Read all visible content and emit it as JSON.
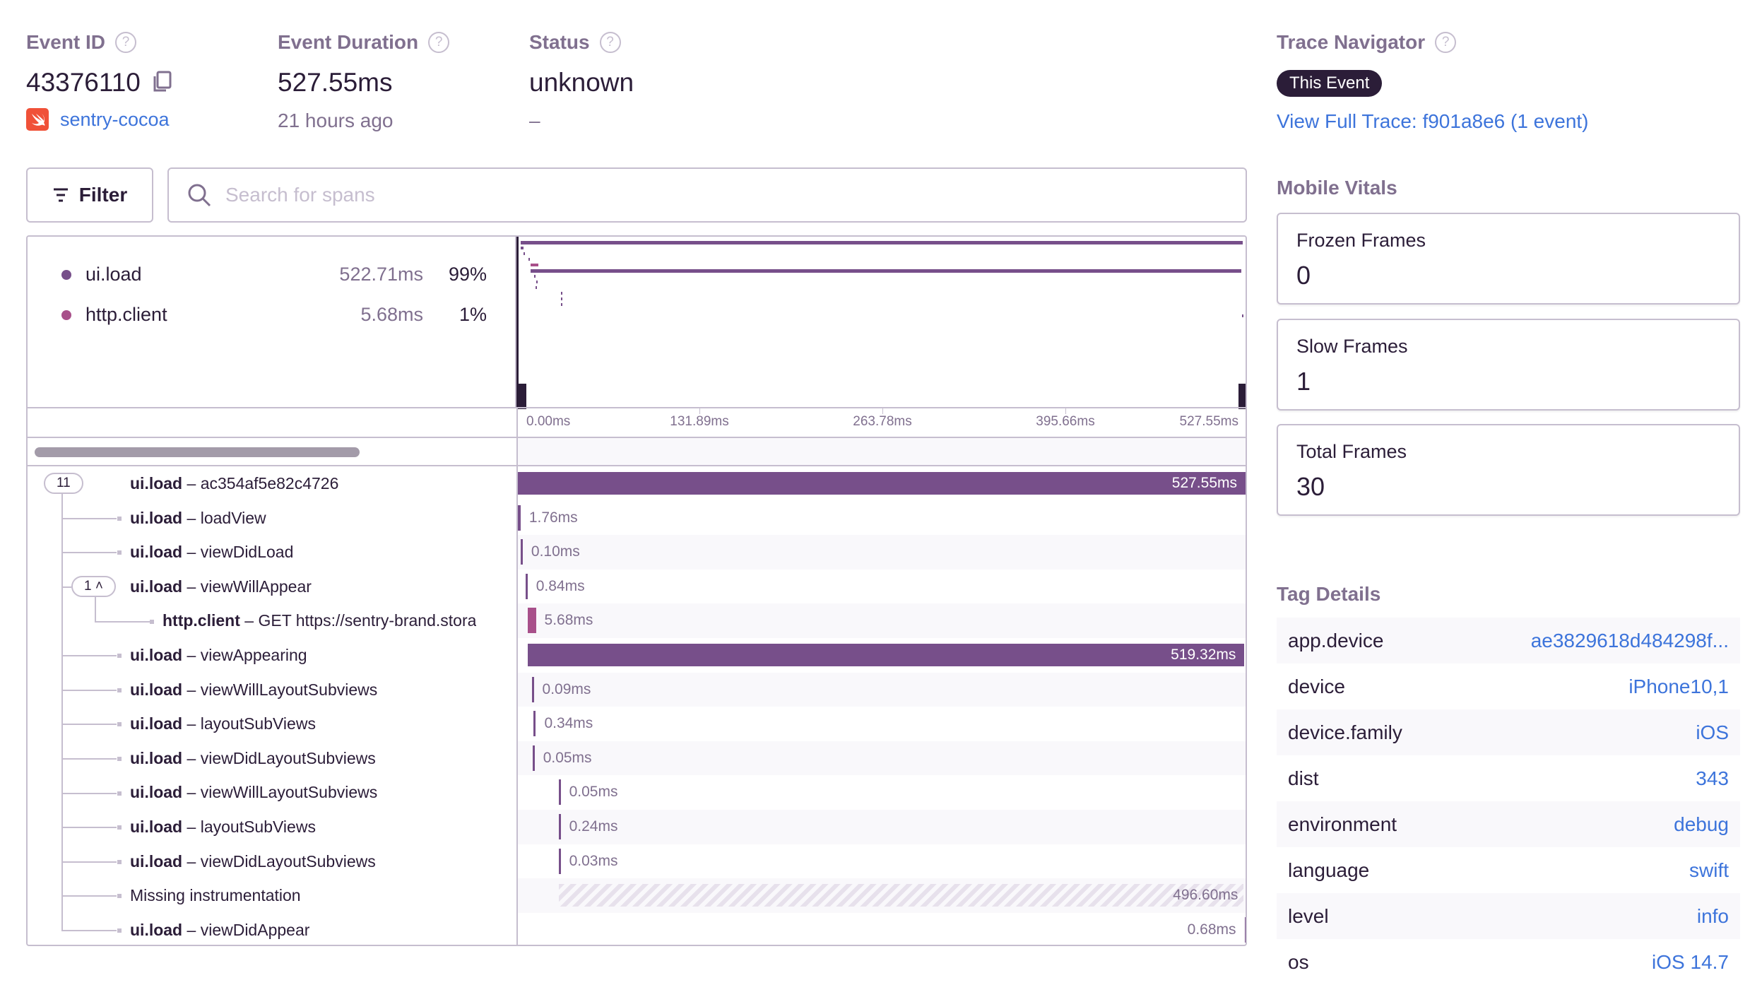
{
  "header": {
    "event_id": {
      "label": "Event ID",
      "value": "43376110",
      "project": "sentry-cocoa"
    },
    "duration": {
      "label": "Event Duration",
      "value": "527.55ms",
      "time_ago": "21 hours ago"
    },
    "status": {
      "label": "Status",
      "value": "unknown",
      "sub": "–"
    }
  },
  "toolbar": {
    "filter_label": "Filter",
    "search_placeholder": "Search for spans"
  },
  "ops_breakdown": [
    {
      "op": "ui.load",
      "duration": "522.71ms",
      "percent": "99%",
      "color": "#774f8a"
    },
    {
      "op": "http.client",
      "duration": "5.68ms",
      "percent": "1%",
      "color": "#a8508a"
    }
  ],
  "timeline": {
    "total_ms": 527.55,
    "ticks": [
      "0.00ms",
      "131.89ms",
      "263.78ms",
      "395.66ms",
      "527.55ms"
    ],
    "tick_values": [
      0,
      131.89,
      263.78,
      395.66,
      527.55
    ]
  },
  "spans": [
    {
      "op": "ui.load",
      "desc": "ac354af5e82c4726",
      "badge": "11",
      "depth": 0,
      "start": 0,
      "dur": 527.55,
      "label": "527.55ms"
    },
    {
      "op": "ui.load",
      "desc": "loadView",
      "depth": 1,
      "start": 0.2,
      "dur": 1.76,
      "label": "1.76ms"
    },
    {
      "op": "ui.load",
      "desc": "viewDidLoad",
      "depth": 1,
      "start": 2.0,
      "dur": 0.1,
      "label": "0.10ms"
    },
    {
      "op": "ui.load",
      "desc": "viewWillAppear",
      "badge": "1 ^",
      "depth": 1,
      "start": 5.5,
      "dur": 0.84,
      "label": "0.84ms"
    },
    {
      "op": "http.client",
      "desc": "GET https://sentry-brand.stora",
      "depth": 2,
      "start": 7.4,
      "dur": 5.68,
      "label": "5.68ms",
      "color": "#a8508a"
    },
    {
      "op": "ui.load",
      "desc": "viewAppearing",
      "depth": 1,
      "start": 7.4,
      "dur": 519.32,
      "label": "519.32ms"
    },
    {
      "op": "ui.load",
      "desc": "viewWillLayoutSubviews",
      "depth": 1,
      "start": 10.0,
      "dur": 0.09,
      "label": "0.09ms"
    },
    {
      "op": "ui.load",
      "desc": "layoutSubViews",
      "depth": 1,
      "start": 11.5,
      "dur": 0.34,
      "label": "0.34ms"
    },
    {
      "op": "ui.load",
      "desc": "viewDidLayoutSubviews",
      "depth": 1,
      "start": 10.6,
      "dur": 0.05,
      "label": "0.05ms"
    },
    {
      "op": "ui.load",
      "desc": "viewWillLayoutSubviews",
      "depth": 1,
      "start": 29.5,
      "dur": 0.05,
      "label": "0.05ms"
    },
    {
      "op": "ui.load",
      "desc": "layoutSubViews",
      "depth": 1,
      "start": 29.5,
      "dur": 0.24,
      "label": "0.24ms"
    },
    {
      "op": "ui.load",
      "desc": "viewDidLayoutSubviews",
      "depth": 1,
      "start": 29.5,
      "dur": 0.03,
      "label": "0.03ms"
    },
    {
      "op": "",
      "desc": "Missing instrumentation",
      "depth": 1,
      "start": 29.6,
      "dur": 496.6,
      "label": "496.60ms",
      "missing": true
    },
    {
      "op": "ui.load",
      "desc": "viewDidAppear",
      "depth": 1,
      "start": 526.8,
      "dur": 0.68,
      "label": "0.68ms"
    }
  ],
  "trace_navigator": {
    "label": "Trace Navigator",
    "current": "This Event",
    "full_trace_link": "View Full Trace: f901a8e6 (1 event)"
  },
  "mobile_vitals": {
    "label": "Mobile Vitals",
    "items": [
      {
        "name": "Frozen Frames",
        "value": "0"
      },
      {
        "name": "Slow Frames",
        "value": "1"
      },
      {
        "name": "Total Frames",
        "value": "30"
      }
    ]
  },
  "tag_details": {
    "label": "Tag Details",
    "items": [
      {
        "key": "app.device",
        "value": "ae3829618d484298f..."
      },
      {
        "key": "device",
        "value": "iPhone10,1"
      },
      {
        "key": "device.family",
        "value": "iOS"
      },
      {
        "key": "dist",
        "value": "343"
      },
      {
        "key": "environment",
        "value": "debug"
      },
      {
        "key": "language",
        "value": "swift"
      },
      {
        "key": "level",
        "value": "info"
      },
      {
        "key": "os",
        "value": "iOS 14.7"
      }
    ]
  }
}
